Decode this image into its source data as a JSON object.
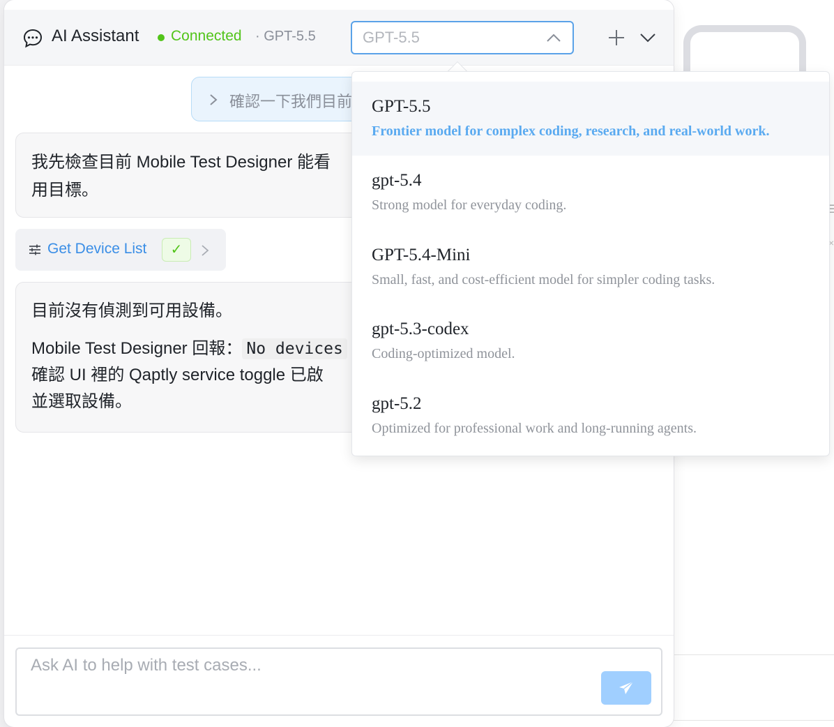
{
  "header": {
    "title": "AI Assistant",
    "status": "Connected",
    "model_label": "· GPT-5.5",
    "selected_model": "GPT-5.5"
  },
  "chat": {
    "quote_chip_text": "確認一下我們目前的",
    "bubble1_lines": [
      "我先檢查目前 Mobile Test Designer 能看",
      "用目標。"
    ],
    "tool_call": {
      "label": "Get Device List",
      "status_mark": "✓"
    },
    "bubble2": {
      "line1": "目前沒有偵測到可用設備。",
      "line2_prefix": "Mobile Test Designer 回報：",
      "line2_code": "No devices",
      "line3": "確認 UI 裡的 Qaptly service toggle 已啟",
      "line4": "並選取設備。"
    }
  },
  "input": {
    "placeholder": "Ask AI to help with test cases..."
  },
  "dropdown": {
    "options": [
      {
        "name": "GPT-5.5",
        "desc": "Frontier model for complex coding, research, and real-world work.",
        "selected": true
      },
      {
        "name": "gpt-5.4",
        "desc": "Strong model for everyday coding."
      },
      {
        "name": "GPT-5.4-Mini",
        "desc": "Small, fast, and cost-efficient model for simpler coding tasks."
      },
      {
        "name": "gpt-5.3-codex",
        "desc": "Coding-optimized model."
      },
      {
        "name": "gpt-5.2",
        "desc": "Optimized for professional work and long-running agents."
      }
    ]
  },
  "colors": {
    "accent": "#3a8ee6",
    "connected": "#52c41a",
    "selected_desc": "#5aaaf0",
    "send_button": "#a0cfff"
  }
}
